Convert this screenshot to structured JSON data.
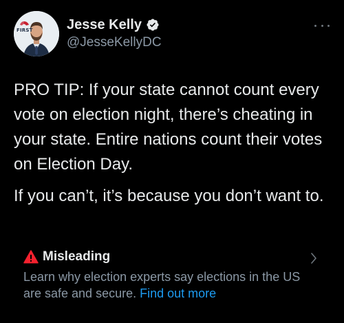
{
  "author": {
    "display_name": "Jesse Kelly",
    "handle": "@JesseKellyDC",
    "avatar_logo_text": "FIRST",
    "verified_icon": "verified-badge-icon"
  },
  "tweet": {
    "paragraphs": [
      "PRO TIP: If your state cannot count every vote on election night, there’s cheating in your state. Entire nations count their votes on Election Day.",
      "If you can’t, it’s because you don’t want to."
    ]
  },
  "notice": {
    "icon": "warning-icon",
    "title": "Misleading",
    "body": "Learn why election experts say elections in the US are safe and secure.",
    "link": "Find out more"
  },
  "colors": {
    "background": "#000000",
    "text": "#e7e9ea",
    "secondary": "#8b98a5",
    "link": "#1d9bf0",
    "warning": "#f4212e"
  }
}
